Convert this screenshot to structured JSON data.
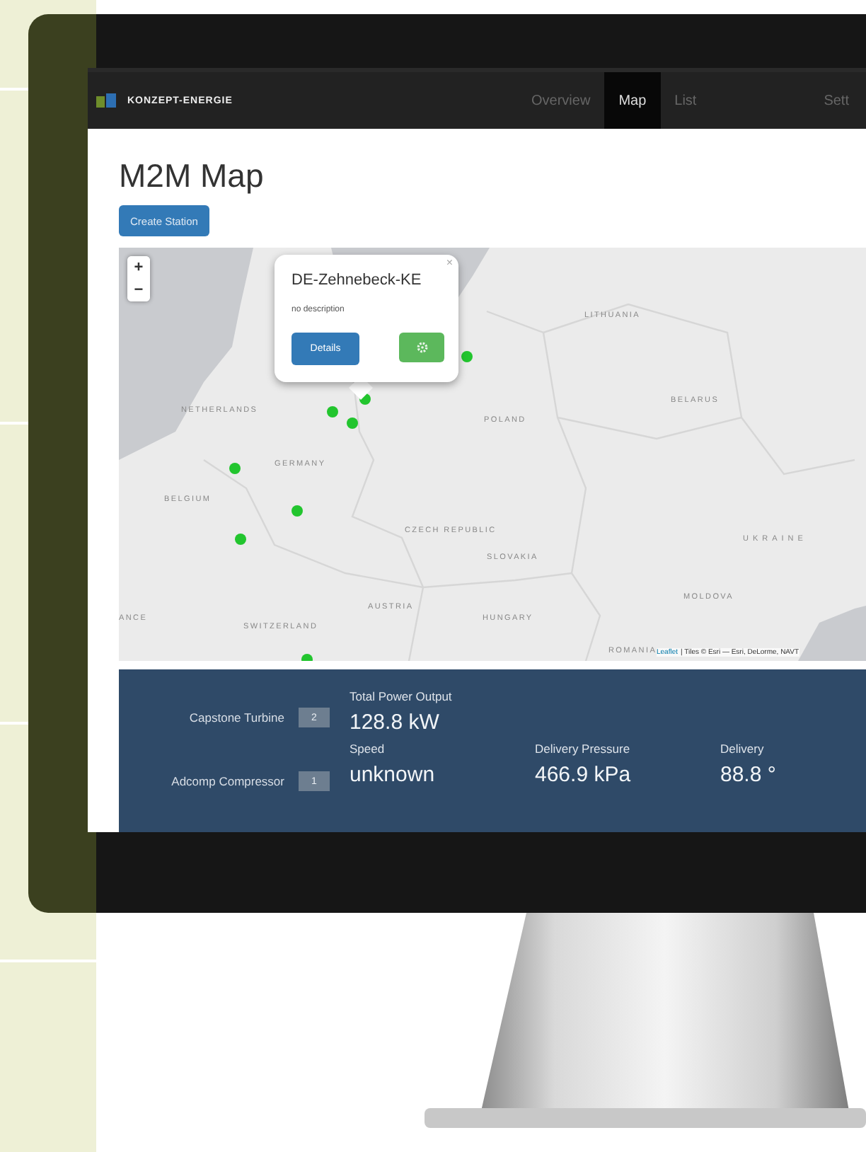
{
  "brand": {
    "name": "KONZEPT-ENERGIE"
  },
  "nav": [
    {
      "label": "Overview",
      "selected": false
    },
    {
      "label": "Map",
      "selected": true
    },
    {
      "label": "List",
      "selected": false
    },
    {
      "label": "Sett",
      "selected": false
    }
  ],
  "page": {
    "title": "M2M Map",
    "create_button": "Create Station"
  },
  "map": {
    "zoom_in": "+",
    "zoom_out": "−",
    "labels": [
      "LITHUANIA",
      "BELARUS",
      "POLAND",
      "NETHERLANDS",
      "GERMANY",
      "BELGIUM",
      "CZECH REPUBLIC",
      "SLOVAKIA",
      "UKRAINE",
      "AUSTRIA",
      "HUNGARY",
      "MOLDOVA",
      "SWITZERLAND",
      "ANCE",
      "ROMANIA"
    ],
    "popup": {
      "title": "DE-Zehnebeck-KE",
      "description": "no description",
      "details_button": "Details",
      "close": "×"
    },
    "attribution_link": "Leaflet",
    "attribution": "| Tiles © Esri — Esri, DeLorme, NAVT"
  },
  "stats": {
    "devices": [
      {
        "name": "Capstone Turbine",
        "count": "2"
      },
      {
        "name": "Adcomp Compressor",
        "count": "1"
      }
    ],
    "metric_rows": [
      [
        {
          "label": "Total Power Output",
          "value": "128.8 kW"
        }
      ],
      [
        {
          "label": "Speed",
          "value": "unknown"
        },
        {
          "label": "Delivery Pressure",
          "value": "466.9 kPa"
        },
        {
          "label": "Delivery",
          "value": "88.8 °"
        }
      ]
    ]
  }
}
